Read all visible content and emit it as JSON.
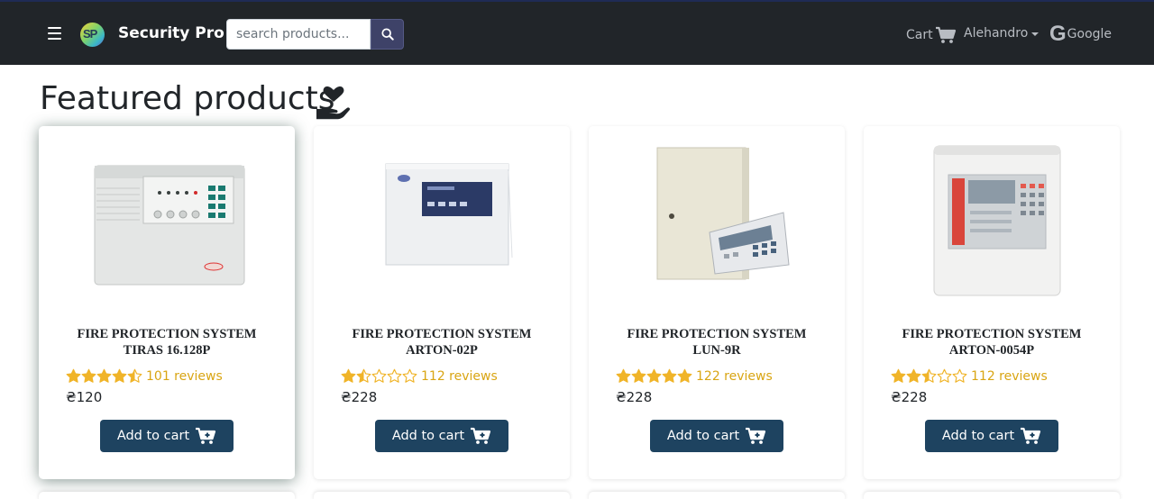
{
  "navbar": {
    "brand": "Security Pro",
    "logo_text": "SP",
    "search_placeholder": "search products...",
    "cart_label": "Cart",
    "user_label": "Alehandro",
    "google_label": "Google",
    "google_letter": "G"
  },
  "page": {
    "heading": "Featured products"
  },
  "products": [
    {
      "title_line1": "FIRE PROTECTION SYSTEM",
      "title_line2": "TIRAS 16.128P",
      "rating": 4.5,
      "reviews": "101 reviews",
      "price": "₴120",
      "button": "Add to cart"
    },
    {
      "title_line1": "FIRE PROTECTION SYSTEM",
      "title_line2": "ARTON-02P",
      "rating": 1.5,
      "reviews": "112 reviews",
      "price": "₴228",
      "button": "Add to cart"
    },
    {
      "title_line1": "FIRE PROTECTION SYSTEM",
      "title_line2": "LUN-9R",
      "rating": 5,
      "reviews": "122 reviews",
      "price": "₴228",
      "button": "Add to cart"
    },
    {
      "title_line1": "FIRE PROTECTION SYSTEM",
      "title_line2": "ARTON-0054P",
      "rating": 2.5,
      "reviews": "112 reviews",
      "price": "₴228",
      "button": "Add to cart"
    }
  ],
  "colors": {
    "navbar_bg": "#212529",
    "button_bg": "#1e4360",
    "star": "#f0b429",
    "reviews_text": "#d9a513"
  }
}
